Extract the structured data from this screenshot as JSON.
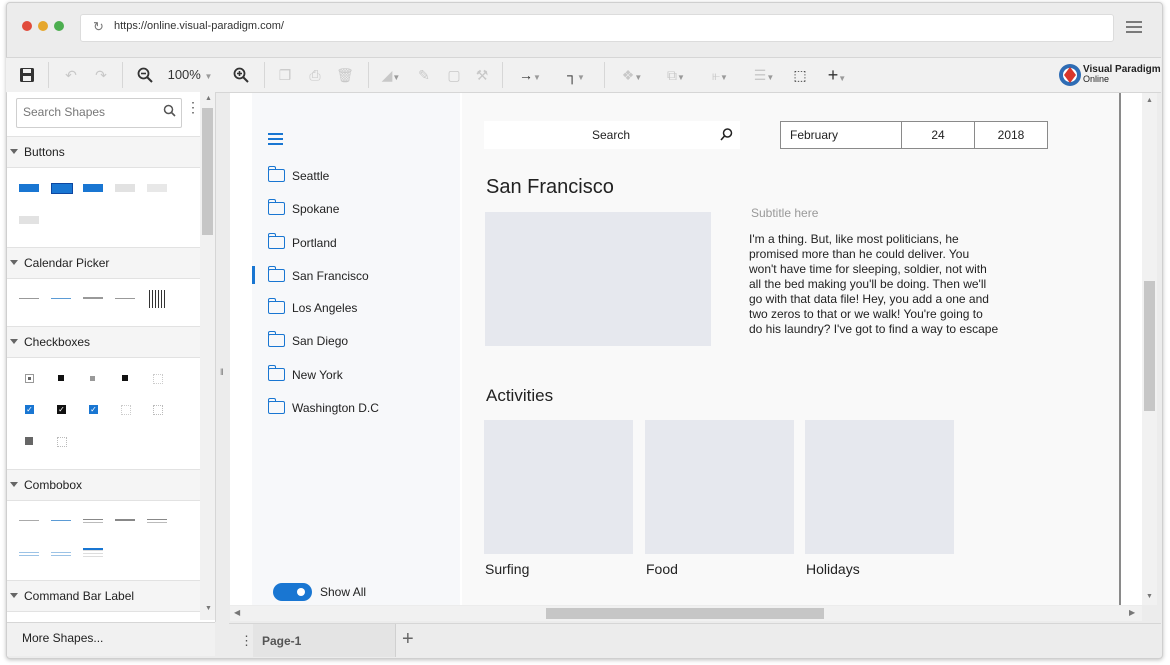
{
  "browser": {
    "url": "https://online.visual-paradigm.com/",
    "dot_colors": [
      "#e14b3b",
      "#e6a72c",
      "#4cae4f"
    ]
  },
  "toolbar": {
    "zoom": "100%",
    "icons": [
      "save-icon",
      "undo-icon",
      "redo-icon",
      "zoom-out-icon",
      "zoom-in-icon",
      "copy-icon",
      "paste-icon",
      "delete-icon",
      "fill-icon",
      "line-color-icon",
      "shadow-icon",
      "format-painter-icon",
      "connector-icon",
      "waypoint-icon",
      "group-icon",
      "arrange-icon",
      "align-icon",
      "distribute-icon",
      "select-all-icon",
      "add-icon"
    ]
  },
  "brand": {
    "line1": "Visual Paradigm",
    "line2": "Online"
  },
  "shapes_panel": {
    "search_placeholder": "Search Shapes",
    "categories": [
      "Buttons",
      "Calendar Picker",
      "Checkboxes",
      "Combobox",
      "Command Bar Label"
    ],
    "more_shapes": "More Shapes..."
  },
  "wireframe": {
    "nav": {
      "items": [
        "Seattle",
        "Spokane",
        "Portland",
        "San Francisco",
        "Los Angeles",
        "San Diego",
        "New York",
        "Washington D.C"
      ],
      "selected": "San Francisco",
      "toggle_label": "Show All",
      "toggle_on": true
    },
    "search_label": "Search",
    "date": {
      "month": "February",
      "day": "24",
      "year": "2018"
    },
    "title": "San Francisco",
    "subtitle": "Subtitle here",
    "body_lines": [
      "I'm a thing. But, like most politicians, he",
      "promised more than he could deliver. You",
      "won't have time for sleeping, soldier, not with",
      "all the bed making you'll be doing. Then we'll",
      "go with that data file! Hey, you add a one and",
      "two zeros to that or we walk! You're going to",
      "do his laundry? I've got to find a way to escape"
    ],
    "activities_heading": "Activities",
    "activities": [
      "Surfing",
      "Food",
      "Holidays"
    ],
    "accent": "#1976d2",
    "placeholder_color": "#e6e8ee"
  },
  "pages": {
    "current": "Page-1"
  }
}
